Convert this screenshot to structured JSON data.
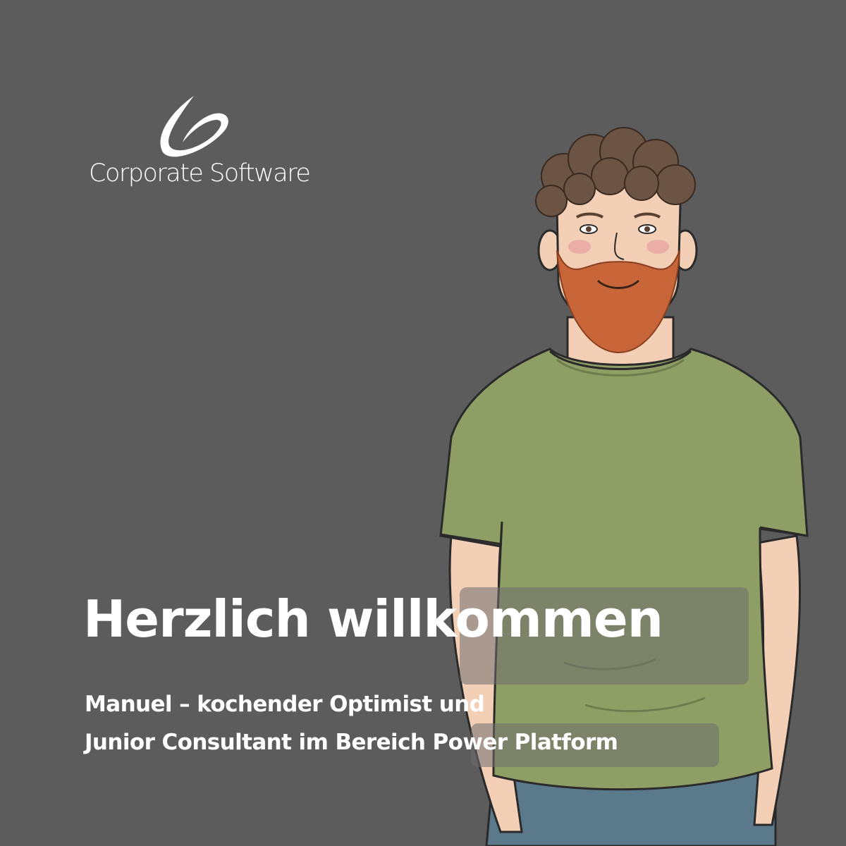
{
  "logo": {
    "text": "Corporate Software",
    "icon": "swirl-logo-icon"
  },
  "headline": "Herzlich willkommen",
  "subline": [
    "Manuel – kochender Optimist und",
    "Junior Consultant im Bereich Power Platform"
  ],
  "colors": {
    "background": "#5c5c5c",
    "text": "#ffffff",
    "shirt": "#8e9e64",
    "hair": "#6b5444",
    "beard": "#c8663a",
    "skin": "#f2cfb5",
    "jeans": "#5a7a8c"
  }
}
